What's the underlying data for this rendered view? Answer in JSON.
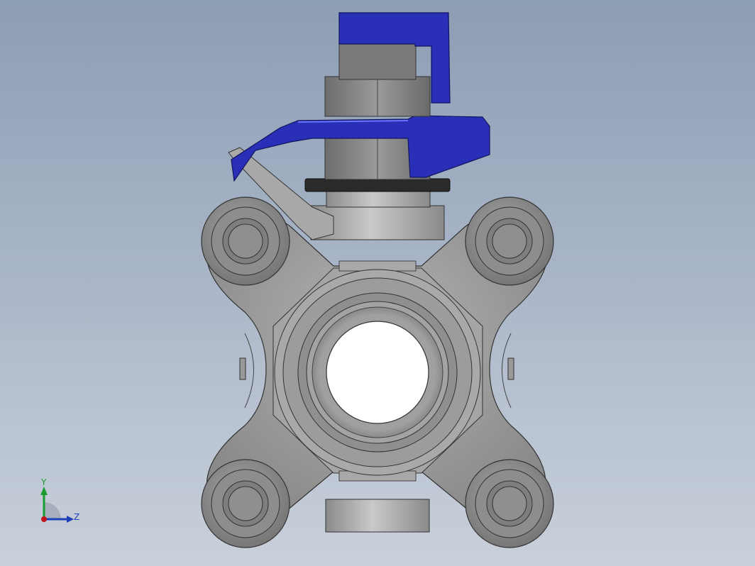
{
  "viewport": {
    "model": "ball-valve-3pc-front-view"
  },
  "triad": {
    "y_label": "Y",
    "z_label": "Z",
    "colors": {
      "y": "#1a9b2e",
      "z": "#1f3fb8",
      "x": "#c0141a"
    }
  },
  "colors": {
    "handle": "#2a2fb8",
    "body": "#9a9a9a",
    "bolt": "#8a8a8a"
  }
}
